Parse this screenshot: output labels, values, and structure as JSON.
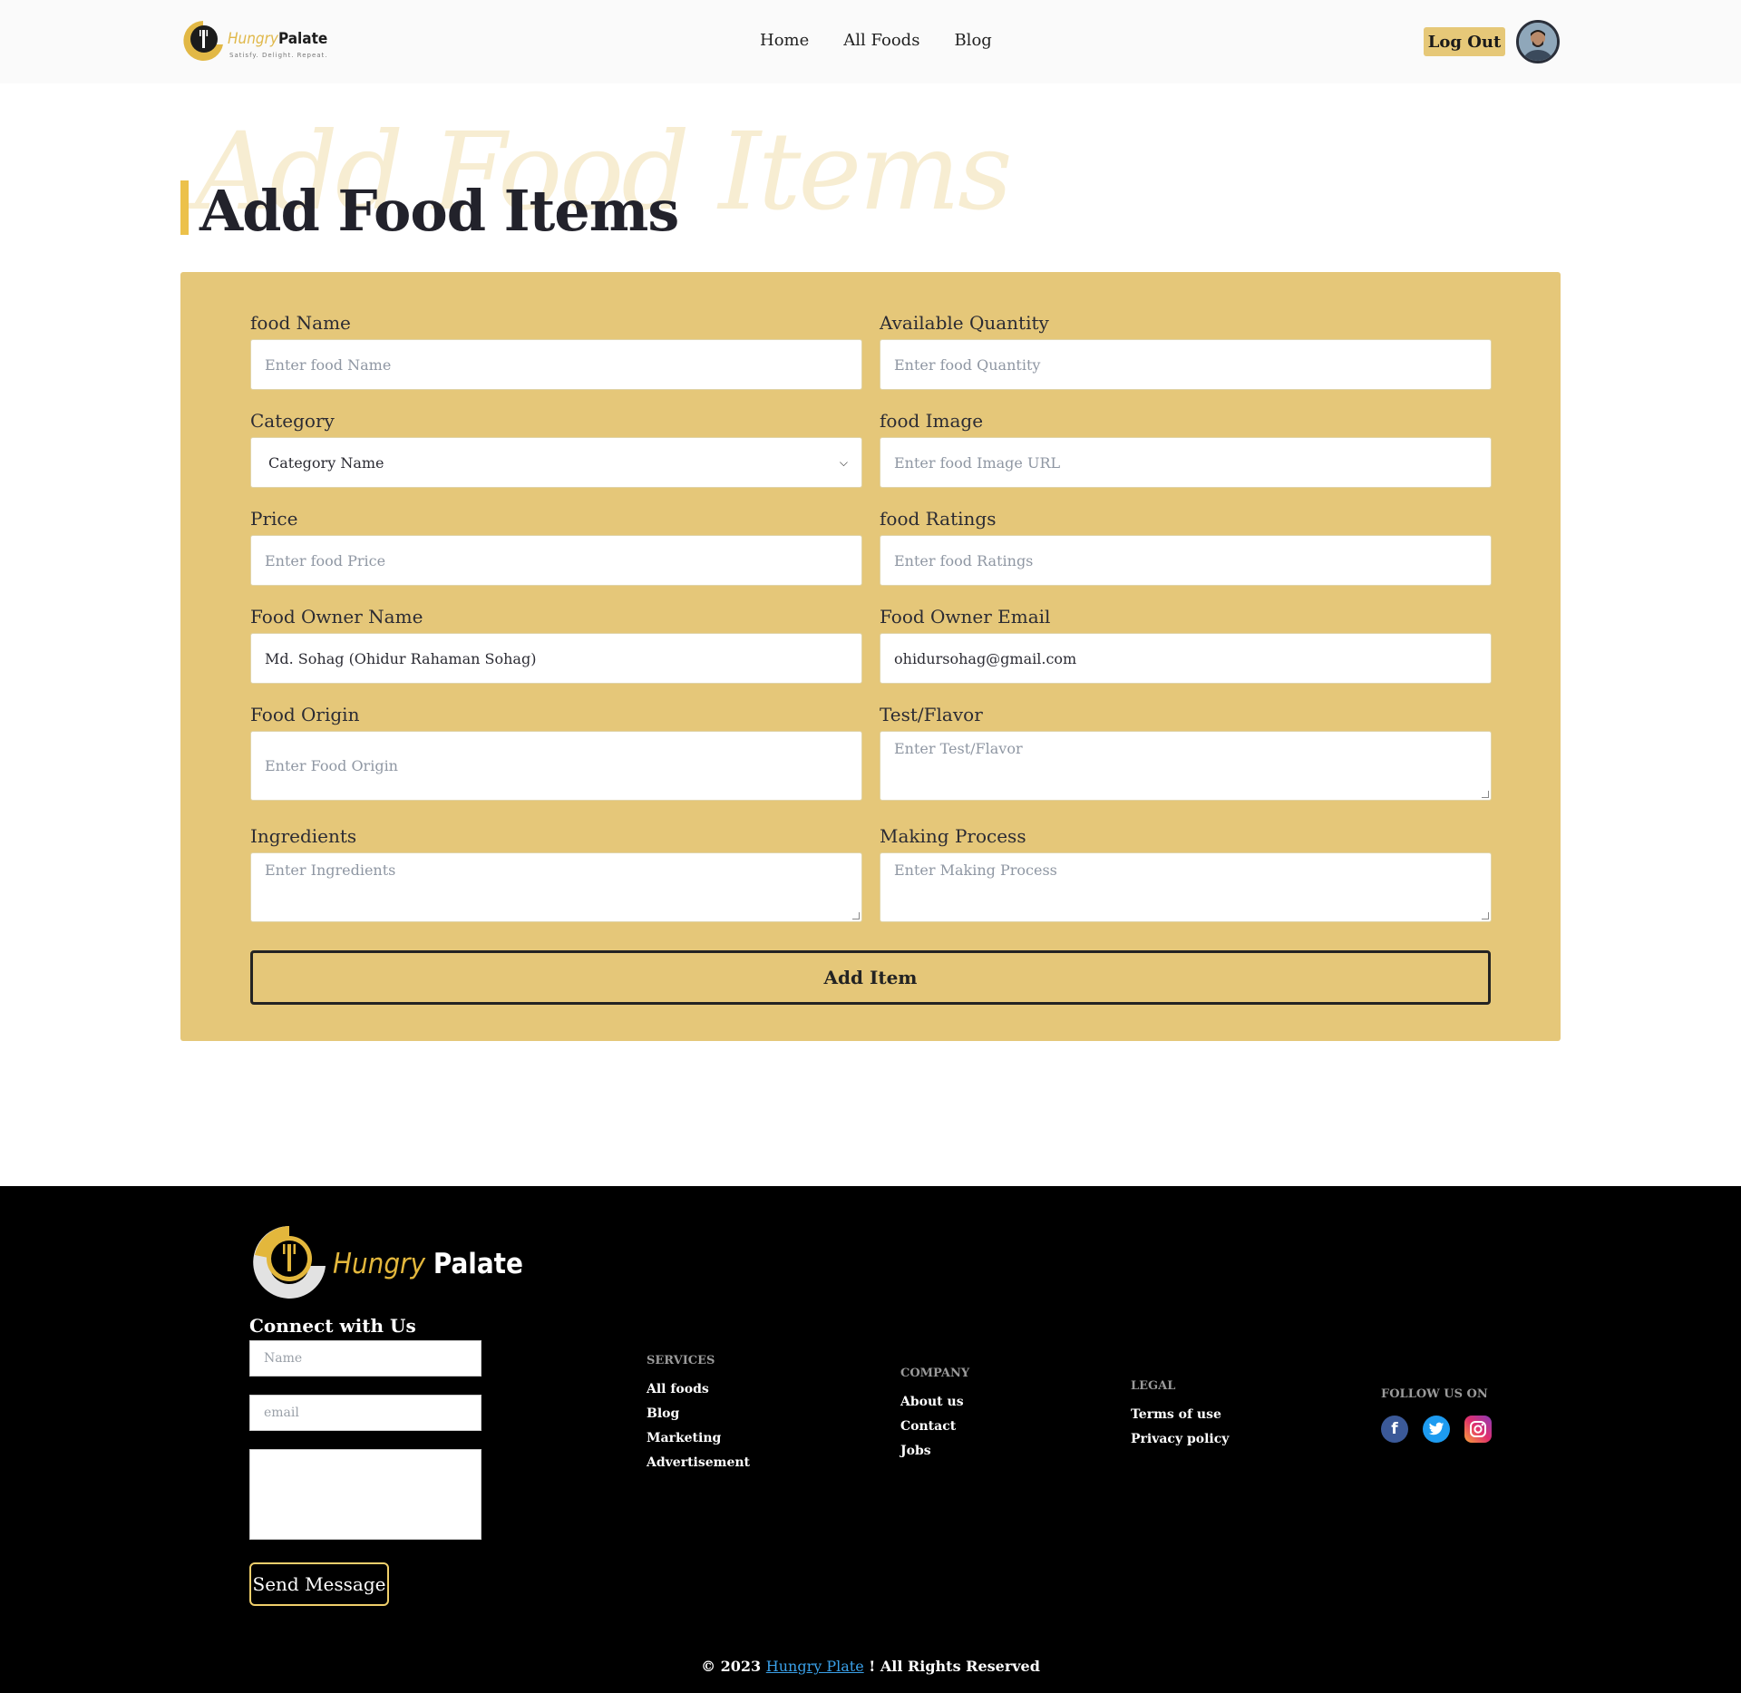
{
  "brand": {
    "name_part1": "Hungry",
    "name_part2": "Palate",
    "tagline": "Satisfy. Delight. Repeat.",
    "accent_color": "#e5c779"
  },
  "nav": {
    "links": [
      "Home",
      "All Foods",
      "Blog"
    ],
    "logout_label": "Log Out"
  },
  "page": {
    "title": "Add Food Items",
    "title_watermark": "Add Food Items"
  },
  "form": {
    "fields": {
      "food_name": {
        "label": "food Name",
        "placeholder": "Enter food Name"
      },
      "available_quantity": {
        "label": "Available Quantity",
        "placeholder": "Enter food Quantity"
      },
      "category": {
        "label": "Category",
        "value": "Category Name"
      },
      "food_image": {
        "label": "food Image",
        "placeholder": "Enter food Image URL"
      },
      "price": {
        "label": "Price",
        "placeholder": "Enter food Price"
      },
      "food_ratings": {
        "label": "food Ratings",
        "placeholder": "Enter food Ratings"
      },
      "owner_name": {
        "label": "Food Owner Name",
        "value": "Md. Sohag (Ohidur Rahaman Sohag)"
      },
      "owner_email": {
        "label": "Food Owner Email",
        "value": "ohidursohag@gmail.com"
      },
      "food_origin": {
        "label": "Food Origin",
        "placeholder": "Enter Food Origin"
      },
      "taste_flavor": {
        "label": "Test/Flavor",
        "placeholder": "Enter Test/Flavor"
      },
      "ingredients": {
        "label": "Ingredients",
        "placeholder": "Enter Ingredients"
      },
      "making_process": {
        "label": "Making Process",
        "placeholder": "Enter Making Process"
      }
    },
    "submit_label": "Add Item"
  },
  "footer": {
    "connect_title": "Connect with Us",
    "name_placeholder": "Name",
    "email_placeholder": "email",
    "send_label": "Send Message",
    "services": {
      "title": "SERVICES",
      "links": [
        "All foods",
        "Blog",
        "Marketing",
        "Advertisement"
      ]
    },
    "company": {
      "title": "COMPANY",
      "links": [
        "About us",
        "Contact",
        "Jobs"
      ]
    },
    "legal": {
      "title": "LEGAL",
      "links": [
        "Terms of use",
        "Privacy policy"
      ]
    },
    "follow": {
      "title": "FOLLOW US ON",
      "icons": [
        "facebook-icon",
        "twitter-icon",
        "instagram-icon"
      ]
    },
    "copyright_prefix": "© 2023",
    "copyright_link": "Hungry Plate",
    "copyright_suffix": "! All Rights Reserved"
  }
}
